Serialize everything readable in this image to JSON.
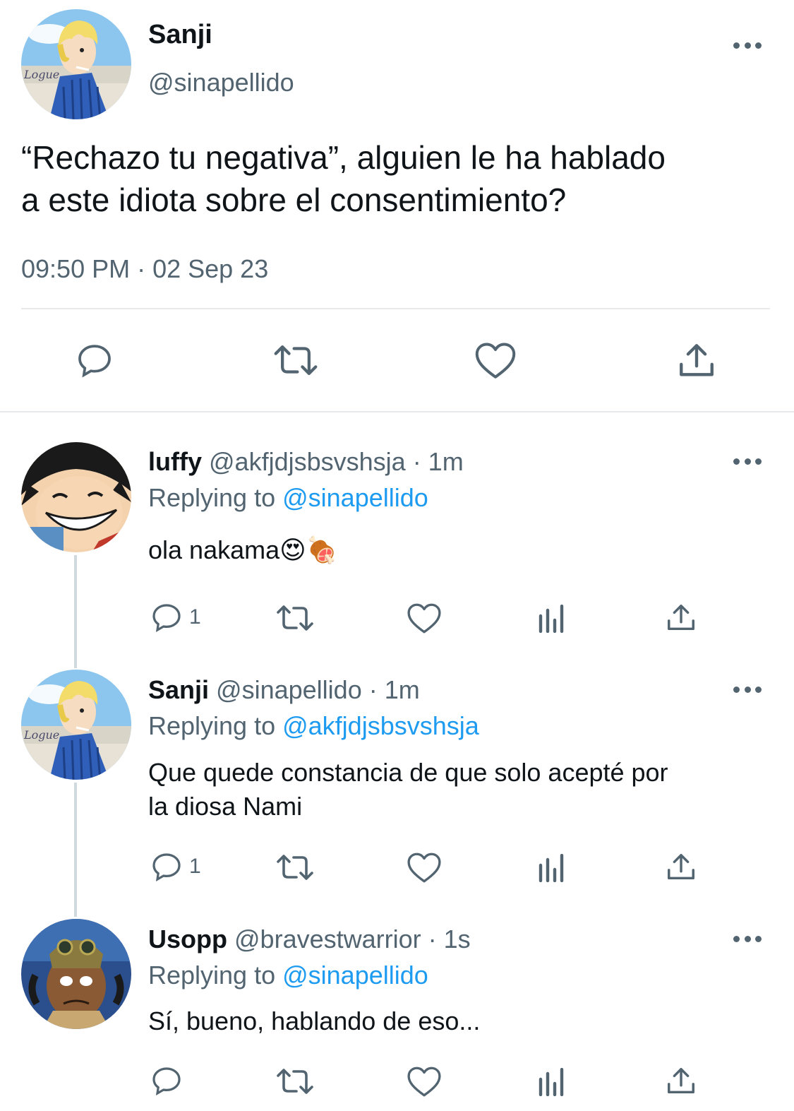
{
  "main_tweet": {
    "display_name": "Sanji",
    "handle": "@sinapellido",
    "text_line1": "“Rechazo tu negativa”, alguien le ha hablado",
    "text_line2": "a este idiota sobre el consentimiento?",
    "timestamp": "09:50 PM · 02 Sep 23",
    "actions": [
      "reply-icon",
      "retweet-icon",
      "like-icon",
      "share-icon"
    ]
  },
  "replies": [
    {
      "display_name": "luffy",
      "handle": "@akfjdjsbsvshsja",
      "time": "· 1m",
      "replying_prefix": "Replying to ",
      "replying_to": "@sinapellido",
      "text_line1": "ola nakama😍🍖",
      "text_line2": "",
      "reply_count": "1"
    },
    {
      "display_name": "Sanji",
      "handle": "@sinapellido",
      "time": "· 1m",
      "replying_prefix": "Replying to ",
      "replying_to": "@akfjdjsbsvshsja",
      "text_line1": "Que quede constancia de que solo acepté por",
      "text_line2": "la diosa Nami",
      "reply_count": "1"
    },
    {
      "display_name": "Usopp",
      "handle": "@bravestwarrior",
      "time": "· 1s",
      "replying_prefix": "Replying to ",
      "replying_to": "@sinapellido",
      "text_line1": "Sí, bueno, hablando de eso...",
      "text_line2": "",
      "reply_count": ""
    }
  ],
  "colors": {
    "text": "#0f1419",
    "secondary": "#536471",
    "link": "#1d9bf0",
    "divider": "#cfd9de"
  }
}
